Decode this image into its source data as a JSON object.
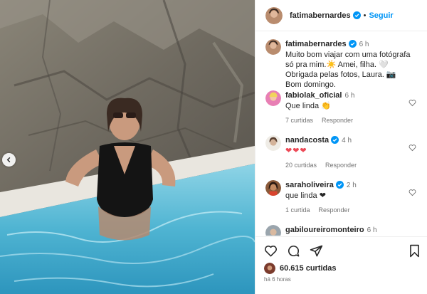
{
  "post": {
    "author": "fatimabernardes",
    "follow_label": "Seguir",
    "separator": "•"
  },
  "caption": {
    "username": "fatimabernardes",
    "time": "6 h",
    "text": "Muito bom viajar com uma fotógrafa só pra mim.☀️ Amei, filha. 🤍 Obrigada pelas fotos, Laura. 📷 Bom domingo."
  },
  "comments": [
    {
      "username": "fabiolak_oficial",
      "verified": false,
      "time": "6 h",
      "text": "Que linda 👏",
      "likes": "7 curtidas",
      "reply": "Responder"
    },
    {
      "username": "nandacosta",
      "verified": true,
      "time": "4 h",
      "text": "❤❤❤",
      "likes": "20 curtidas",
      "reply": "Responder"
    },
    {
      "username": "saraholiveira",
      "verified": true,
      "time": "2 h",
      "text": "que linda ❤",
      "likes": "1 curtida",
      "reply": "Responder"
    },
    {
      "username": "gabiloureiromonteiro",
      "verified": false,
      "time": "6 h",
      "text": "",
      "likes": "",
      "reply": ""
    }
  ],
  "footer": {
    "likes": "60.615 curtidas",
    "posted": "há 6 horas"
  },
  "colors": {
    "accent": "#0095f6",
    "verified": "#0095f6",
    "heart": "#ed4956",
    "muted": "#737373"
  },
  "icons": [
    "chevron-left-icon",
    "verified-icon",
    "heart-outline-icon",
    "comment-icon",
    "share-icon",
    "bookmark-icon"
  ]
}
